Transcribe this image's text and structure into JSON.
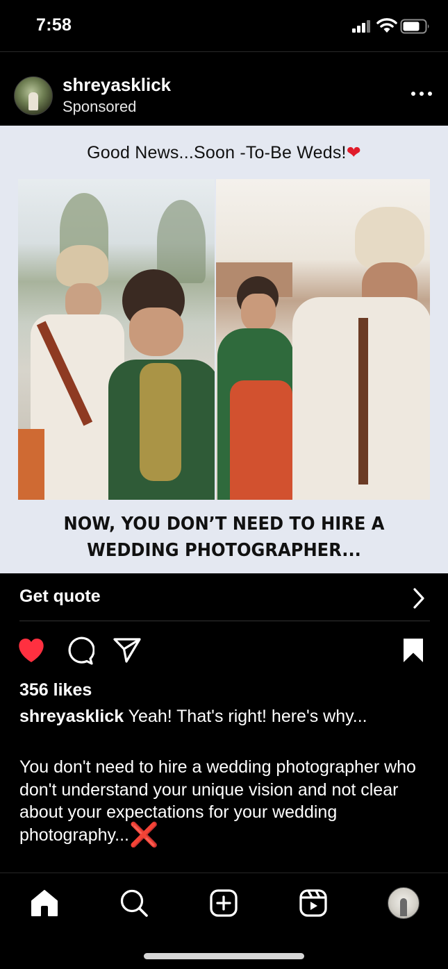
{
  "status_bar": {
    "time": "7:58"
  },
  "post": {
    "username": "shreyasklick",
    "label": "Sponsored",
    "ad": {
      "headline": "Good News...Soon -To-Be Weds!",
      "headline_emoji": "❤",
      "tagline_line1": "NOW, YOU DON’T NEED TO HIRE A",
      "tagline_line2": "WEDDING PHOTOGRAPHER..."
    },
    "cta": {
      "label": "Get quote",
      "icon": "chevron-right-icon"
    },
    "actions": {
      "like_icon": "heart-filled-icon",
      "liked": true,
      "comment_icon": "comment-icon",
      "share_icon": "send-icon",
      "save_icon": "bookmark-filled-icon"
    },
    "likes": "356 likes",
    "caption": {
      "username": "shreyasklick",
      "text": "Yeah! That's right! here's why...",
      "body": "You don't need to hire a wedding photographer who don't understand your unique vision and not clear about your expectations for your wedding photography...",
      "emoji": "❌"
    }
  },
  "bottom_nav": {
    "items": [
      {
        "name": "home",
        "icon": "home-filled-icon",
        "active": true
      },
      {
        "name": "search",
        "icon": "search-icon"
      },
      {
        "name": "create",
        "icon": "plus-square-icon"
      },
      {
        "name": "reels",
        "icon": "reels-icon"
      },
      {
        "name": "profile",
        "icon": "avatar"
      }
    ]
  },
  "colors": {
    "background": "#000000",
    "like": "#ff3040",
    "ad_background": "#e4e8f1",
    "text": "#ffffff"
  }
}
